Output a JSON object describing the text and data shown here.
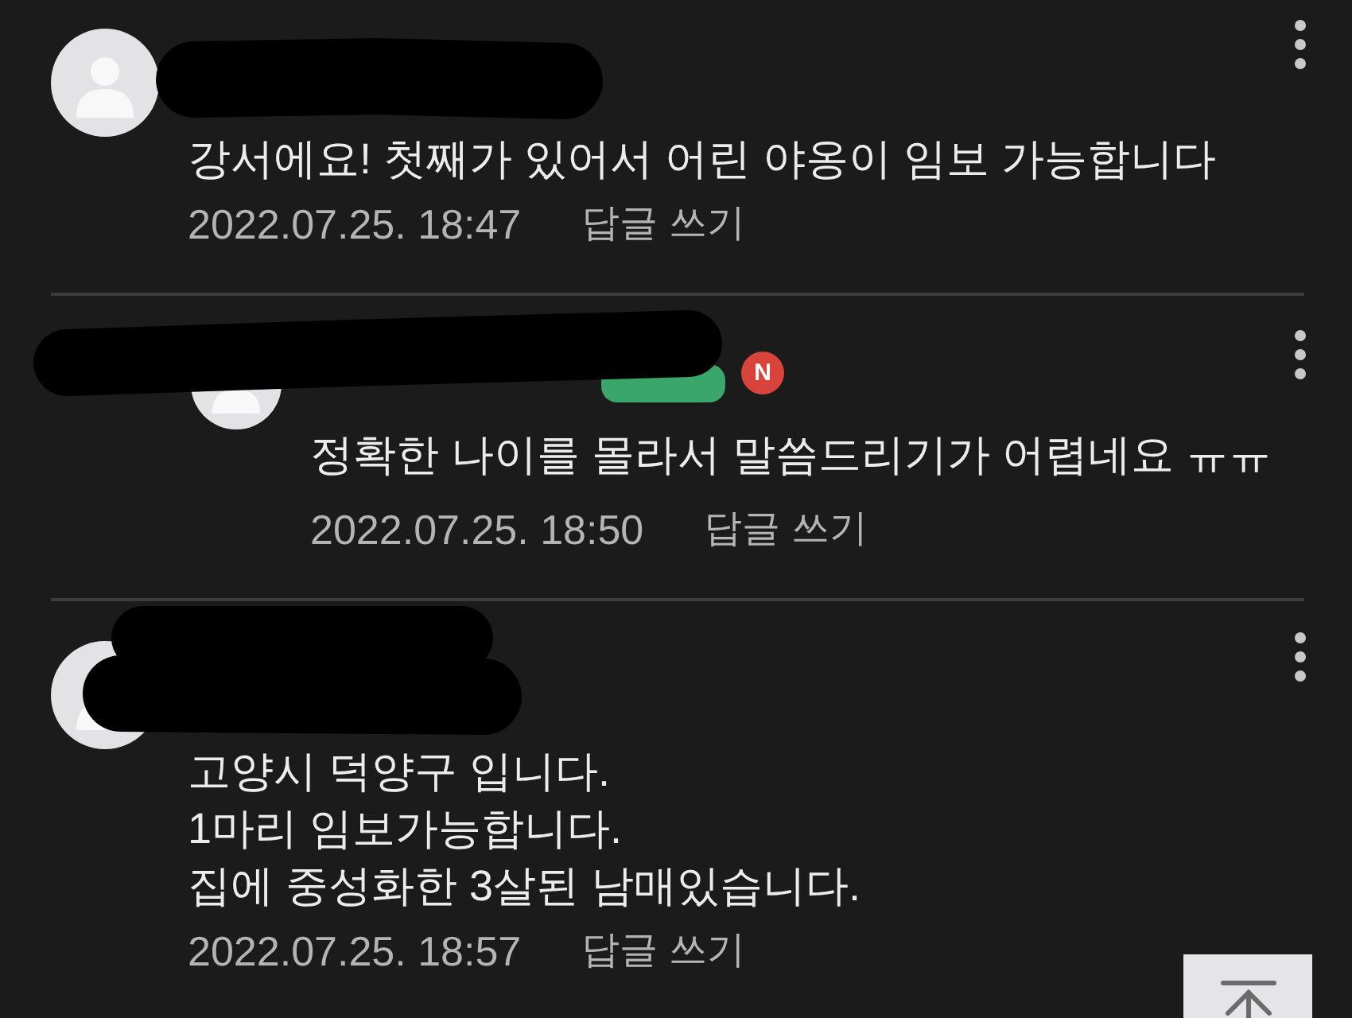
{
  "comments": [
    {
      "is_reply": false,
      "name_redacted": true,
      "text": "강서에요! 첫째가 있어서 어린 야옹이 임보 가능합니다",
      "date": "2022.07.25. 18:47",
      "reply_label": "답글 쓰기"
    },
    {
      "is_reply": true,
      "name_redacted": true,
      "badges": [
        {
          "kind": "grade"
        },
        {
          "kind": "new",
          "text": "N"
        }
      ],
      "text": "정확한 나이를 몰라서 말씀드리기가 어렵네요 ㅠㅠ",
      "date": "2022.07.25. 18:50",
      "reply_label": "답글 쓰기"
    },
    {
      "is_reply": false,
      "name_redacted": true,
      "text": "고양시 덕양구 입니다.\n1마리 임보가능합니다.\n집에 중성화한 3살된 남매있습니다.",
      "date": "2022.07.25. 18:57",
      "reply_label": "답글 쓰기"
    }
  ],
  "scroll_top_button": true
}
